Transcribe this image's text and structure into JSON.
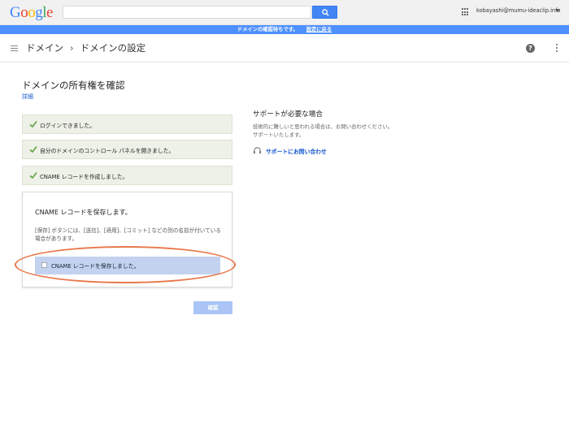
{
  "topbar": {
    "logo": "Google",
    "search_placeholder": "",
    "account_email": "kobayashi@mumu-ideaclip.info"
  },
  "notice": {
    "message": "ドメインの確認待ちです。",
    "link": "設定に戻る"
  },
  "header": {
    "crumb_domain": "ドメイン",
    "crumb_separator": "›",
    "crumb_settings": "ドメインの設定",
    "help_glyph": "?"
  },
  "main": {
    "title": "ドメインの所有権を確認",
    "details_link": "詳細",
    "completed_steps": [
      {
        "label": "ログインできました。"
      },
      {
        "label": "自分のドメインのコントロール パネルを開きました。"
      },
      {
        "label": "CNAME レコードを作成しました。"
      }
    ],
    "current_step": {
      "title": "CNAME レコードを保存します。",
      "description": "[保存] ボタンには、[送信]、[適用]、[コミット] などの別の名前が付いている場合があります。",
      "checkbox_label": "CNAME レコードを保存しました。",
      "checked": false
    },
    "confirm_button": "確認"
  },
  "support": {
    "title": "サポートが必要な場合",
    "description": "技術的に難しいと思われる場合は、お問い合わせください。サポートいたします。",
    "link": "サポートにお問い合わせ"
  },
  "colors": {
    "accent_blue": "#4d90fe",
    "step_bg": "#eef1e7",
    "check_green": "#6aa84f",
    "highlight_orange": "#e8774a",
    "selected_row": "#c3d3ef",
    "disabled_button": "#a9c4f5"
  },
  "icons": [
    "search-icon",
    "apps-grid-icon",
    "caret-down-icon",
    "menu-icon",
    "help-icon",
    "more-vert-icon",
    "check-icon",
    "headset-icon"
  ]
}
